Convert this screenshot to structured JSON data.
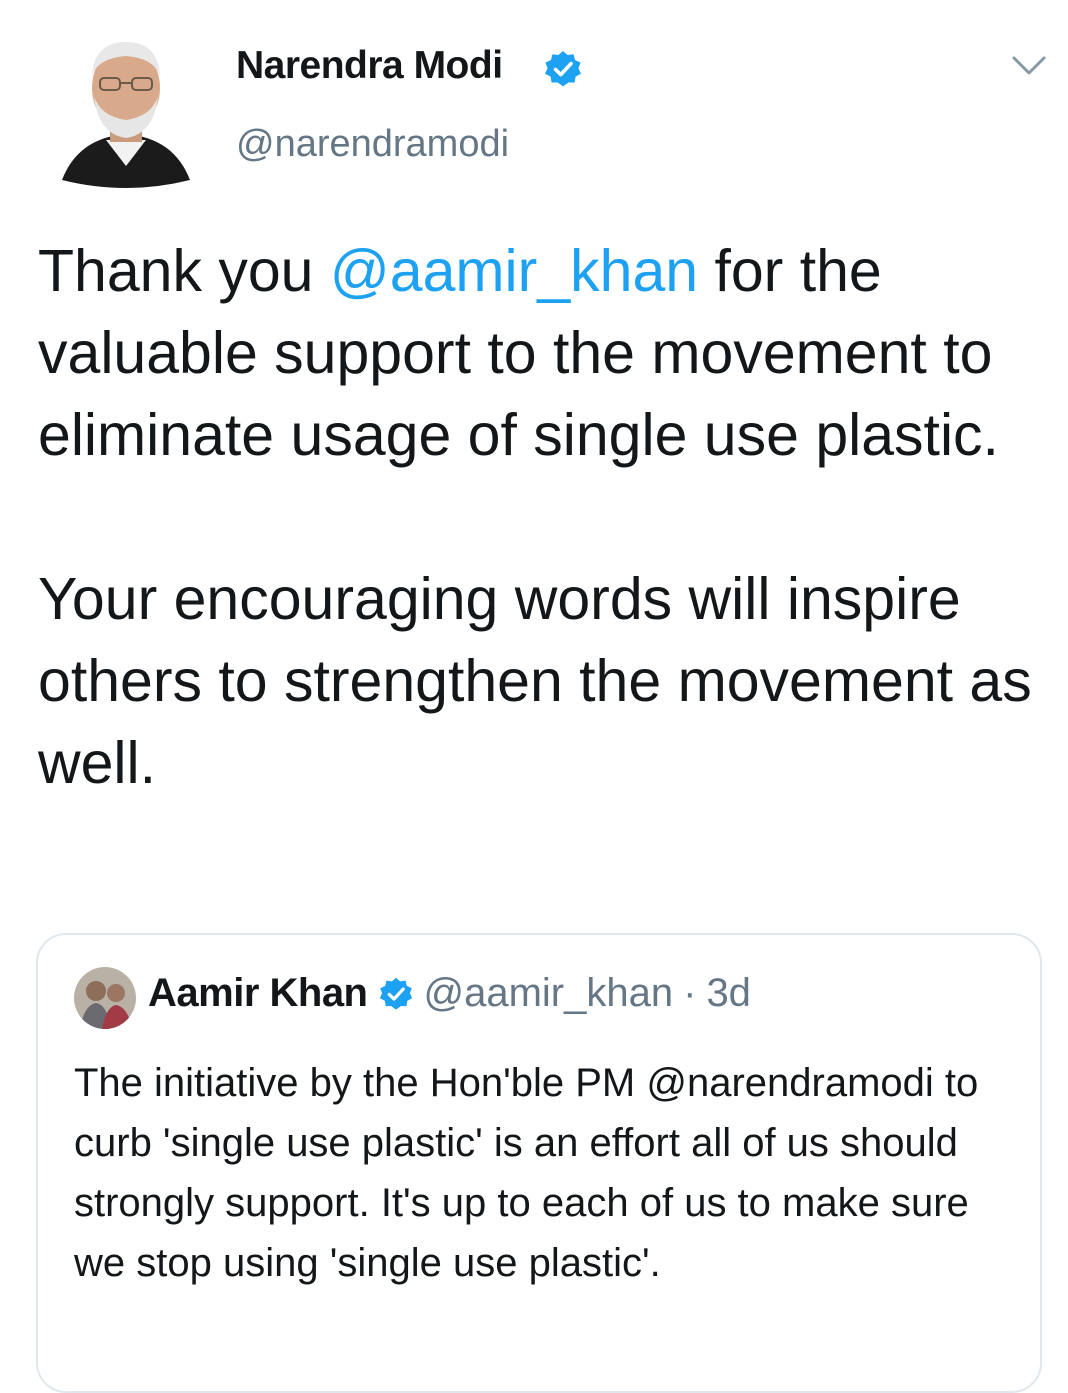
{
  "tweet": {
    "author_name": "Narendra Modi",
    "author_handle": "@narendramodi",
    "body_para1_pre": "Thank you ",
    "body_mention": "@aamir_khan",
    "body_para1_post": " for the valuable support to the movement to eliminate usage of single use plastic.",
    "body_para2": "Your encouraging words will inspire others to strengthen the movement as well.",
    "menu_icon": "chevron-down-icon",
    "verified_icon": "verified-badge-icon"
  },
  "quoted": {
    "author_name": "Aamir Khan",
    "author_handle": "@aamir_khan",
    "separator": "·",
    "time": "3d",
    "text": "The initiative by the Hon'ble PM @narendramodi to curb 'single use plastic' is an effort all of us should strongly support. It's up to each of us to make sure we stop using 'single use plastic'."
  },
  "colors": {
    "link": "#1da1f2",
    "secondary_text": "#657786",
    "primary_text": "#14171a",
    "border": "#e1e8ed"
  }
}
